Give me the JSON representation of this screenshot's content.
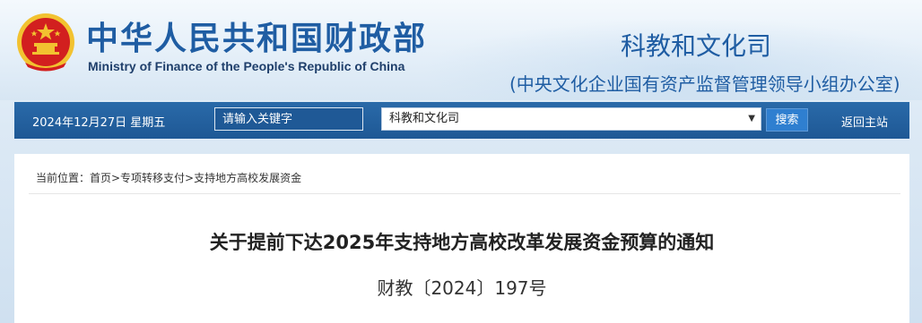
{
  "header": {
    "emblem_icon": "national-emblem-icon",
    "cn_title": "中华人民共和国财政部",
    "en_title": "Ministry of Finance of the People's Republic of China",
    "dept": "科教和文化司",
    "dept_sub": "(中央文化企业国有资产监督管理领导小组办公室)"
  },
  "navbar": {
    "date": "2024年12月27日  星期五",
    "search_placeholder": "请输入关键字",
    "select_value": "科教和文化司",
    "search_button": "搜索",
    "home_link": "返回主站"
  },
  "content": {
    "breadcrumb": "当前位置：首页>专项转移支付>支持地方高校发展资金",
    "title": "关于提前下达2025年支持地方高校改革发展资金预算的通知",
    "doc_number": "财教〔2024〕197号"
  },
  "colors": {
    "brand_blue": "#1f5da3",
    "nav_blue": "#1e5895",
    "emblem_red": "#d21f1f",
    "emblem_gold": "#f2c230"
  }
}
